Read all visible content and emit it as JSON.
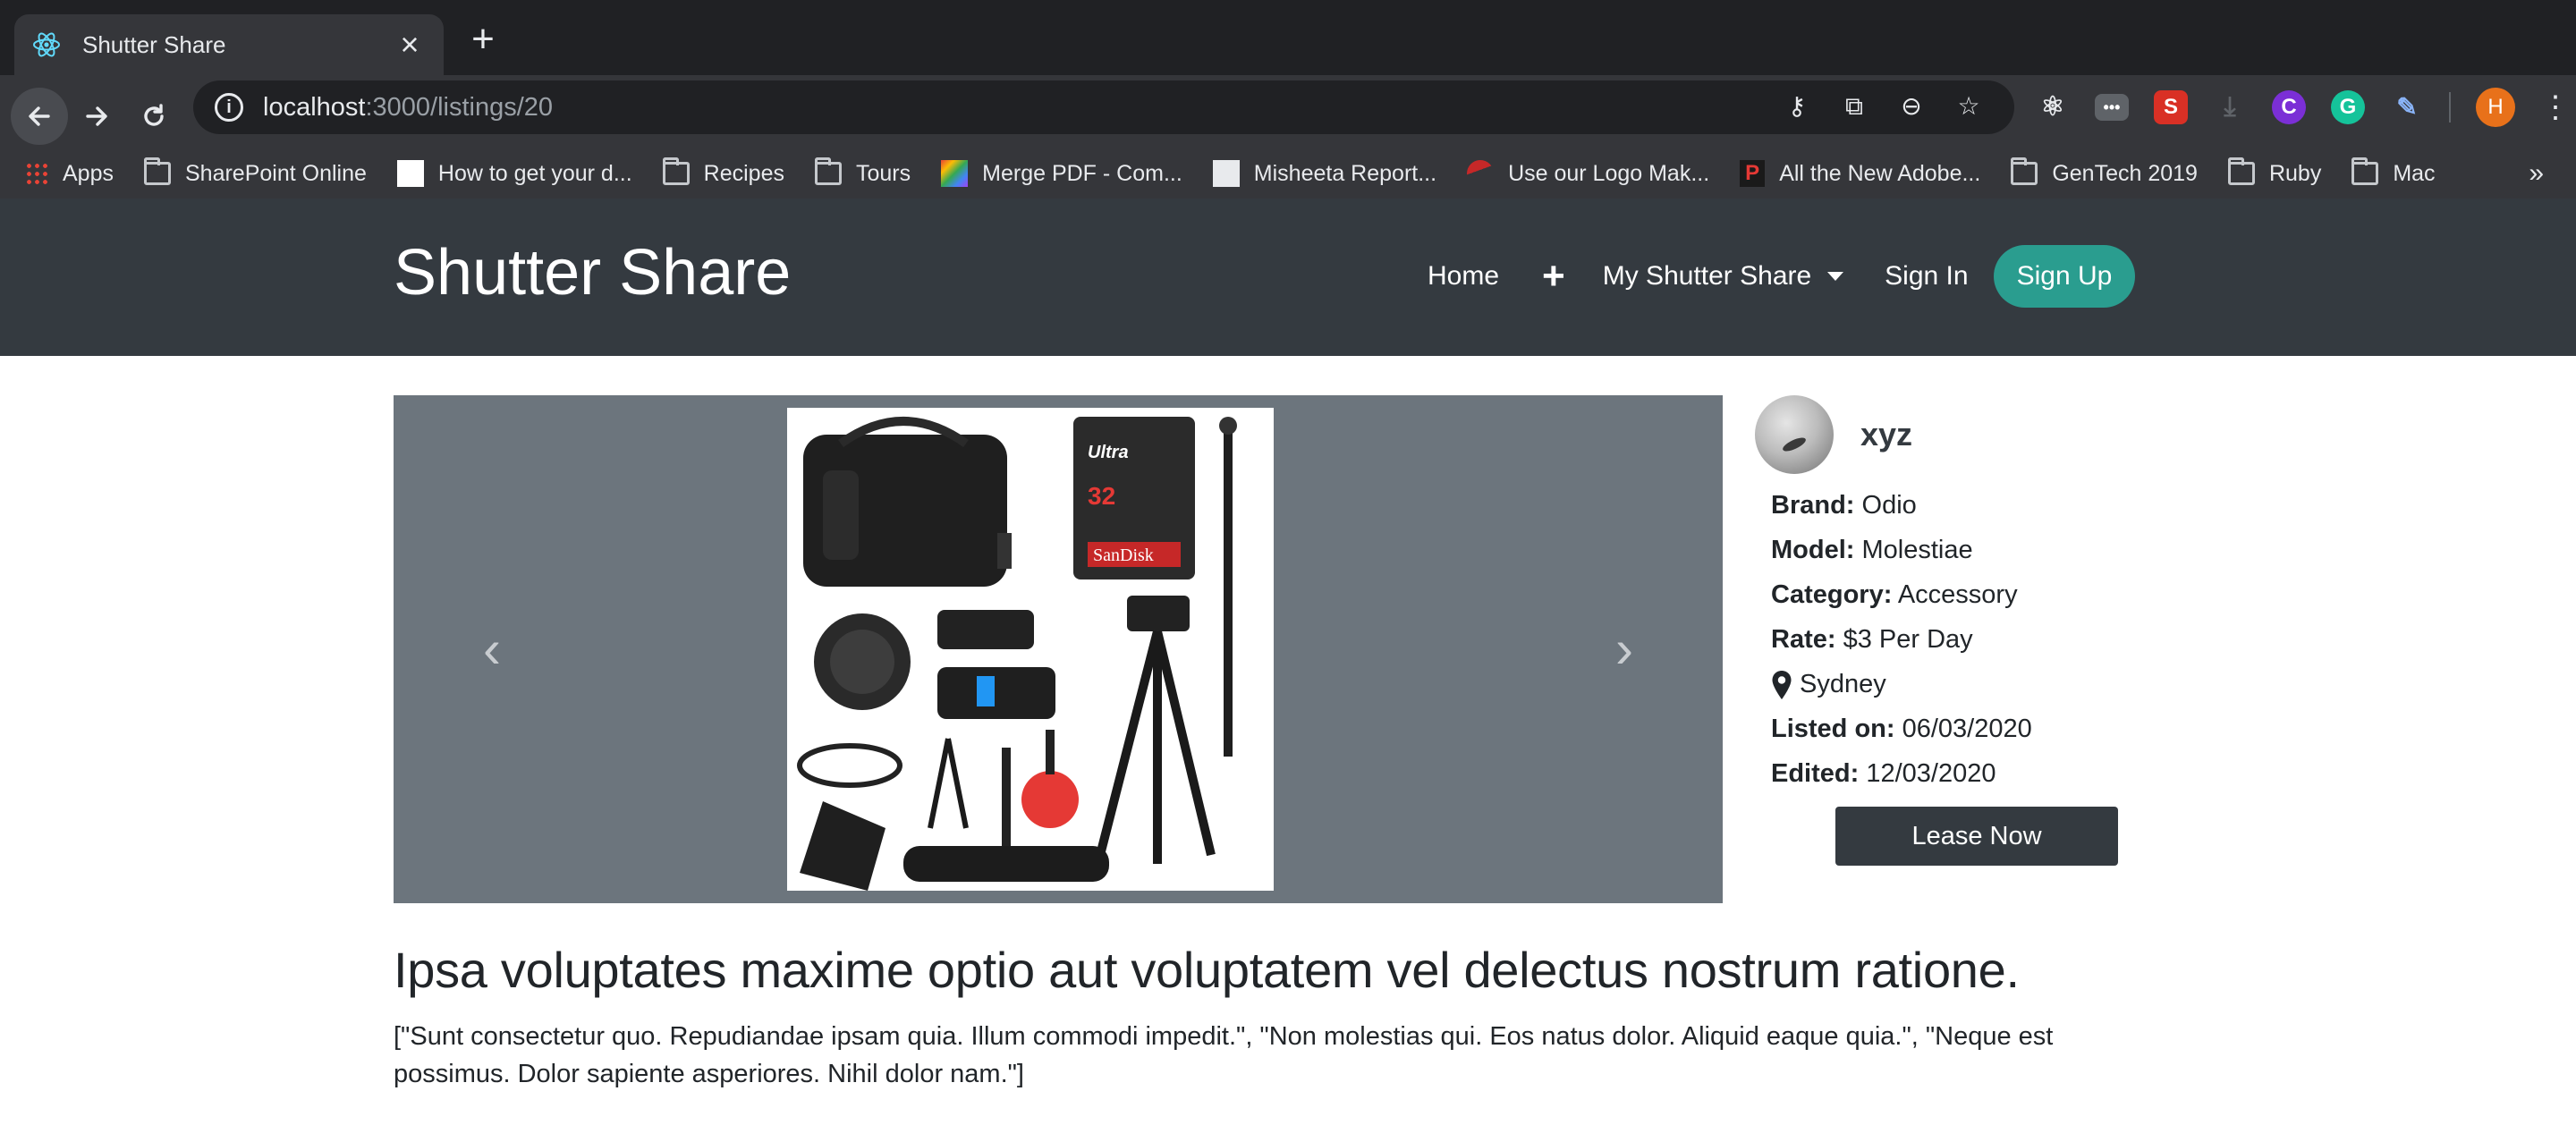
{
  "browser": {
    "tab_title": "Shutter Share",
    "url_host": "localhost",
    "url_path": ":3000/listings/20",
    "profile_initial": "H",
    "bookmarks": [
      {
        "label": "Apps",
        "icon": "apps-grid-icon"
      },
      {
        "label": "SharePoint Online",
        "icon": "folder-icon"
      },
      {
        "label": "How to get your d...",
        "icon": "page-favicon"
      },
      {
        "label": "Recipes",
        "icon": "folder-icon"
      },
      {
        "label": "Tours",
        "icon": "folder-icon"
      },
      {
        "label": "Merge PDF - Com...",
        "icon": "multicolor-favicon"
      },
      {
        "label": "Misheeta Report...",
        "icon": "report-favicon"
      },
      {
        "label": "Use our Logo Mak...",
        "icon": "logo-maker-favicon"
      },
      {
        "label": "All the New Adobe...",
        "icon": "adobe-favicon"
      },
      {
        "label": "GenTech 2019",
        "icon": "folder-icon"
      },
      {
        "label": "Ruby",
        "icon": "folder-icon"
      },
      {
        "label": "Mac",
        "icon": "folder-icon"
      }
    ],
    "bookmarks_more": "»"
  },
  "site": {
    "brand": "Shutter Share",
    "nav": {
      "home": "Home",
      "add": "+",
      "my_shutter_share": "My Shutter Share",
      "sign_in": "Sign In",
      "sign_up": "Sign Up"
    },
    "accent_color": "#2a9d8f",
    "navbar_color": "#343a40"
  },
  "listing": {
    "owner": "xyz",
    "brand_label": "Brand:",
    "brand": "Odio",
    "model_label": "Model:",
    "model": "Molestiae",
    "category_label": "Category:",
    "category": "Accessory",
    "rate_label": "Rate:",
    "rate": "$3 Per Day",
    "location": "Sydney",
    "listed_label": "Listed on:",
    "listed_on": "06/03/2020",
    "edited_label": "Edited:",
    "edited": "12/03/2020",
    "lease_button": "Lease Now",
    "title": "Ipsa voluptates maxime optio aut voluptatem vel delectus nostrum ratione.",
    "description": "[\"Sunt consectetur quo. Repudiandae ipsam quia. Illum commodi impedit.\", \"Non molestias qui. Eos natus dolor. Aliquid eaque quia.\", \"Neque est possimus. Dolor sapiente asperiores. Nihil dolor nam.\"]",
    "carousel_prev": "‹",
    "carousel_next": "›"
  }
}
